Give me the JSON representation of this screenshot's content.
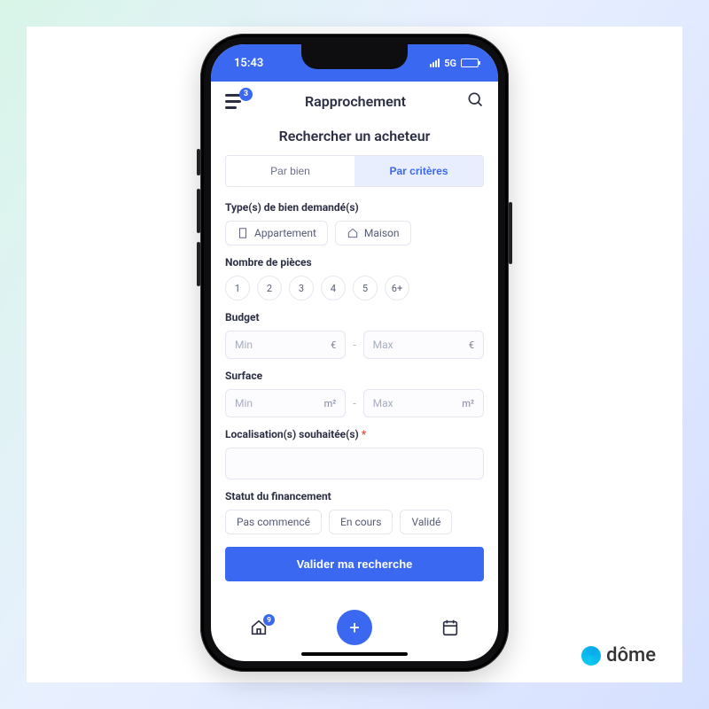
{
  "brand": "dôme",
  "statusbar": {
    "time": "15:43",
    "network": "5G"
  },
  "navbar": {
    "badge": "3",
    "title": "Rapprochement"
  },
  "page": {
    "title": "Rechercher un acheteur"
  },
  "tabs": {
    "byProperty": "Par bien",
    "byCriteria": "Par critères"
  },
  "sections": {
    "type_label": "Type(s) de bien demandé(s)",
    "type_options": {
      "apartment": "Appartement",
      "house": "Maison"
    },
    "rooms_label": "Nombre de pièces",
    "rooms_options": [
      "1",
      "2",
      "3",
      "4",
      "5",
      "6+"
    ],
    "budget_label": "Budget",
    "budget_min_ph": "Min",
    "budget_max_ph": "Max",
    "budget_unit": "€",
    "surface_label": "Surface",
    "surface_min_ph": "Min",
    "surface_max_ph": "Max",
    "surface_unit": "m²",
    "location_label": "Localisation(s) souhaitée(s) ",
    "location_required": "*",
    "financing_label": "Statut du financement",
    "financing_options": {
      "not_started": "Pas commencé",
      "in_progress": "En cours",
      "validated": "Validé"
    }
  },
  "submit": "Valider ma recherche",
  "tabbar": {
    "home_badge": "9"
  },
  "range_separator": "-"
}
